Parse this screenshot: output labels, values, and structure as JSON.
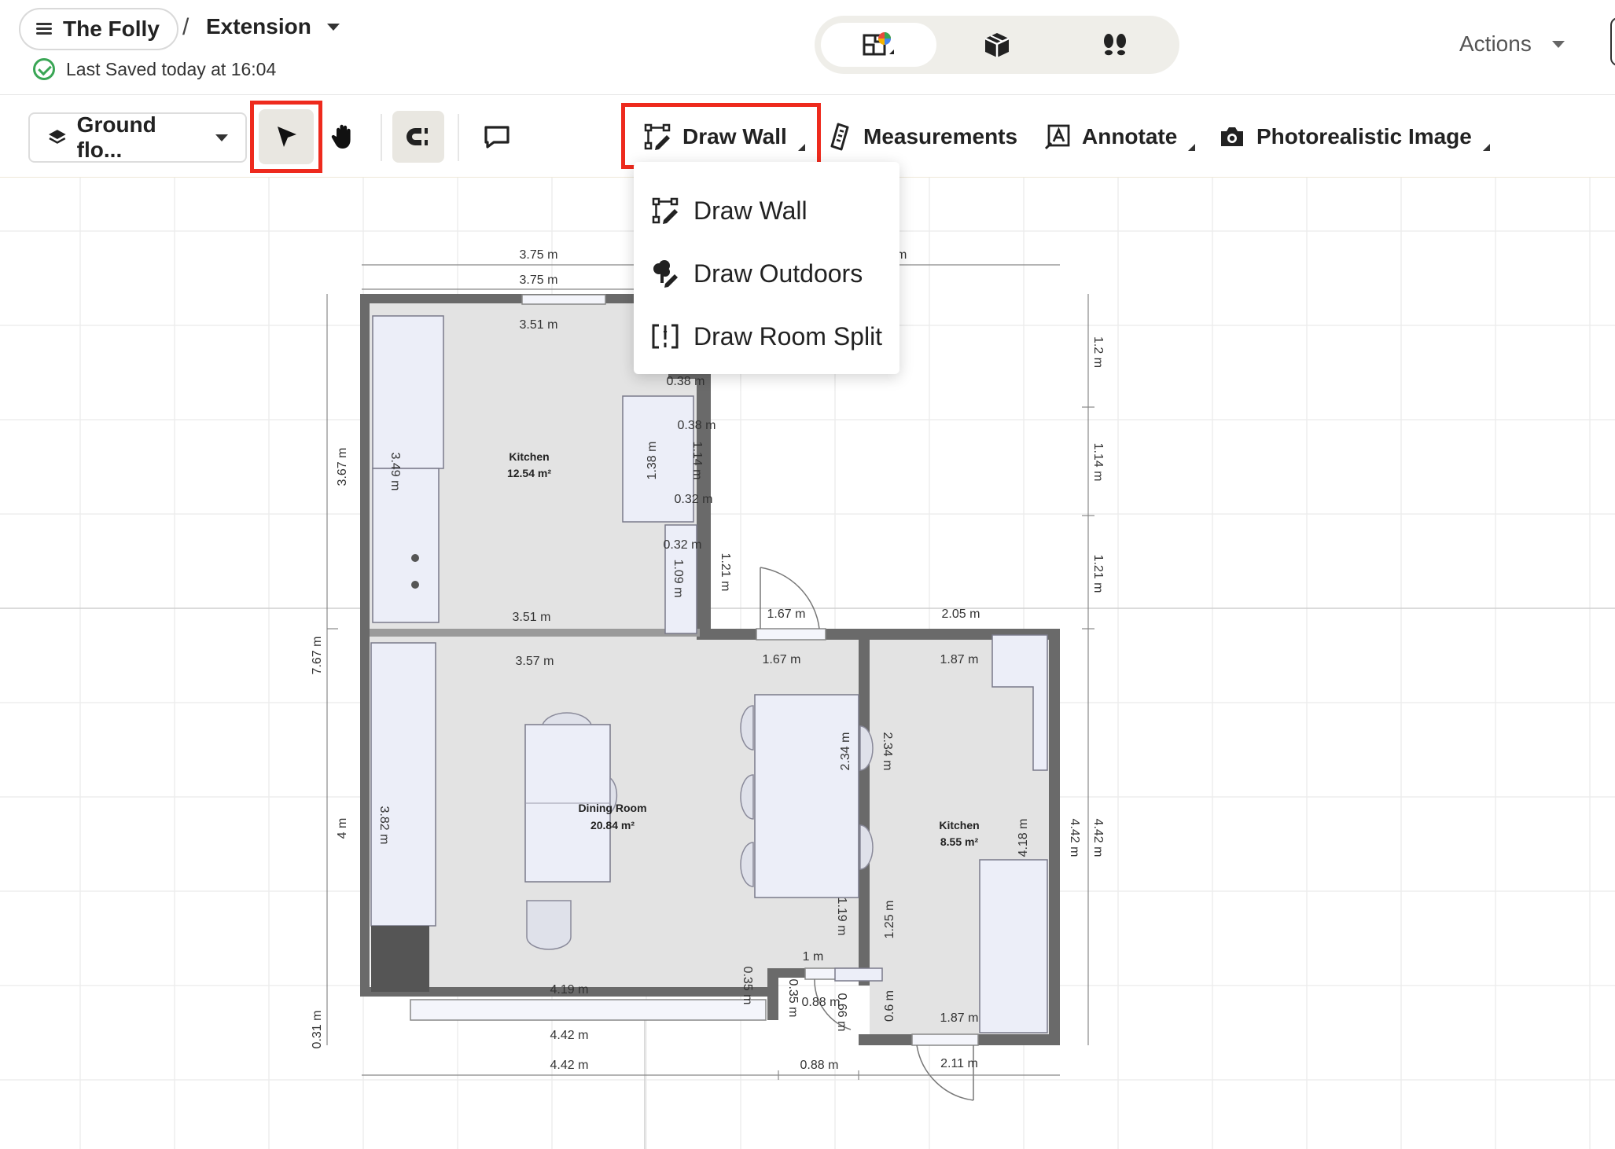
{
  "header": {
    "workspace": "The Folly",
    "separator": "/",
    "project": "Extension",
    "saved_status": "Last Saved today at 16:04",
    "actions_label": "Actions",
    "view_modes": [
      "floor-plan-2d",
      "3d-view",
      "walkthrough"
    ],
    "active_view": "floor-plan-2d"
  },
  "toolbar": {
    "floor_select": "Ground flo...",
    "active_tool": "select",
    "draw_wall": "Draw Wall",
    "measurements": "Measurements",
    "annotate": "Annotate",
    "photorealistic": "Photorealistic Image"
  },
  "dropdown": {
    "items": [
      {
        "label": "Draw Wall",
        "icon": "draw-wall-icon"
      },
      {
        "label": "Draw Outdoors",
        "icon": "draw-outdoors-icon"
      },
      {
        "label": "Draw Room Split",
        "icon": "room-split-icon"
      }
    ]
  },
  "plan": {
    "rooms": [
      {
        "name": "Kitchen",
        "area": "12.54 m²"
      },
      {
        "name": "Dining Room",
        "area": "20.84 m²"
      },
      {
        "name": "Kitchen",
        "area": "8.55 m²"
      }
    ],
    "dims": {
      "top_outer_a": "3.75 m",
      "top_outer_b": "3.75 m",
      "top_right_cut": "m",
      "k_top": "3.51 m",
      "k_bottom": "3.51 m",
      "k_notch_a": "0.38 m",
      "k_notch_b": "0.38 m",
      "k_notch_c": "0.32 m",
      "k_notch_d": "0.32 m",
      "k_cab_h": "1.38 m",
      "k_notch_h": "1.14 m",
      "k_small_h": "1.09 m",
      "k_wall_h": "1.21 m",
      "k_left_h": "3.49 m",
      "left_k": "3.67 m",
      "left_total": "7.67 m",
      "left_d": "4 m",
      "left_bottom": "0.31 m",
      "right_a": "1.2 m",
      "right_b": "1.14 m",
      "right_c": "1.21 m",
      "right_d": "4.42 m",
      "door_top": "1.67 m",
      "door_inner": "1.67 m",
      "k2_top_outer": "2.05 m",
      "k2_top": "1.87 m",
      "d_top": "3.57 m",
      "d_left": "3.82 m",
      "d_bottom": "4.19 m",
      "bottom_a": "4.42 m",
      "bottom_b": "4.42 m",
      "bottom_c": "0.88 m",
      "bottom_d": "2.11 m",
      "d_mid_h": "2.34 m",
      "d_mid_h2": "2.34 m",
      "d_low_h": "1.19 m",
      "k2_low_h": "1.25 m",
      "k2_h": "4.18 m",
      "k2_h_outer": "4.42 m",
      "k2_bottom": "1.87 m",
      "k2_small": "0.6 m",
      "notch_w": "1 m",
      "notch_a": "0.35 m",
      "notch_b": "0.35 m",
      "notch_c": "0.88 m",
      "notch_d": "0.66 m"
    }
  }
}
